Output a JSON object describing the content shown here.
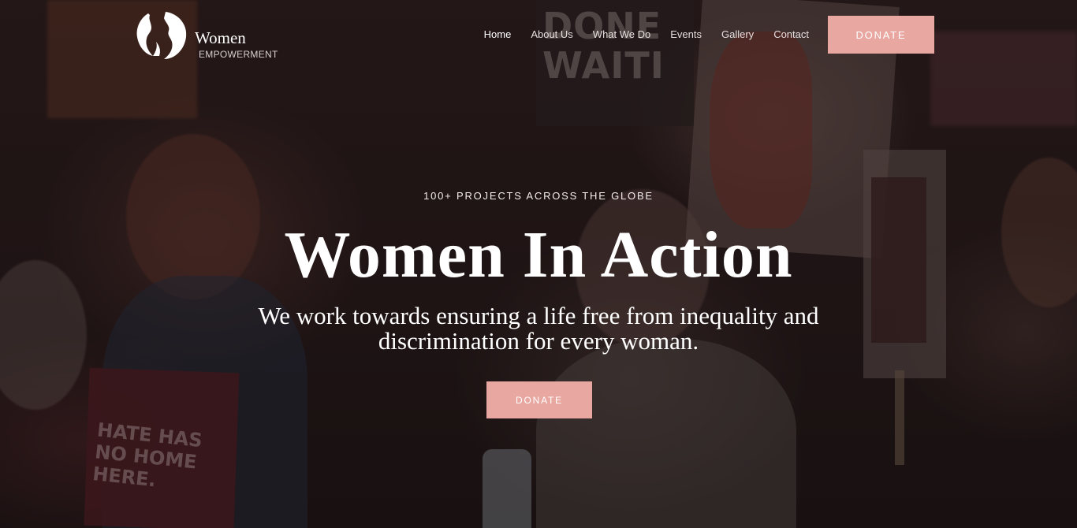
{
  "brand": {
    "title": "Women",
    "subtitle": "EMPOWERMENT",
    "logo_icon": "women-silhouettes-logo-icon"
  },
  "nav": {
    "items": [
      {
        "label": "Home",
        "active": true
      },
      {
        "label": "About Us",
        "active": false
      },
      {
        "label": "What We Do",
        "active": false
      },
      {
        "label": "Events",
        "active": false
      },
      {
        "label": "Gallery",
        "active": false
      },
      {
        "label": "Contact",
        "active": false
      }
    ],
    "donate_label": "DONATE"
  },
  "hero": {
    "kicker": "100+ PROJECTS ACROSS THE GLOBE",
    "title": "Women In Action",
    "subtitle": "We work towards ensuring a life free from inequality and discrimination for every woman.",
    "donate_label": "DONATE"
  },
  "background_signs": {
    "top_sign": "DONE WAITI",
    "left_sign": "HATE HAS NO HOME HERE."
  },
  "colors": {
    "accent": "#e8a7a0",
    "text": "#ffffff"
  }
}
